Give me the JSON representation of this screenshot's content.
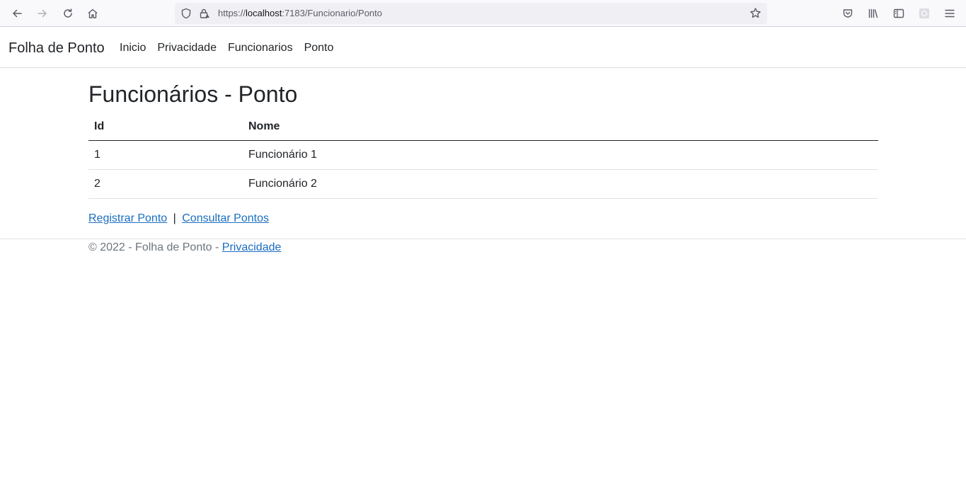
{
  "browser": {
    "url_prefix": "https://",
    "url_host": "localhost",
    "url_rest": ":7183/Funcionario/Ponto"
  },
  "navbar": {
    "brand": "Folha de Ponto",
    "links": [
      "Inicio",
      "Privacidade",
      "Funcionarios",
      "Ponto"
    ]
  },
  "main": {
    "title": "Funcionários - Ponto",
    "table": {
      "headers": [
        "Id",
        "Nome"
      ],
      "rows": [
        [
          "1",
          "Funcionário 1"
        ],
        [
          "2",
          "Funcionário 2"
        ]
      ]
    },
    "actions": {
      "register": "Registrar Ponto",
      "separator": "|",
      "consult": "Consultar Pontos"
    }
  },
  "footer": {
    "text": "© 2022 - Folha de Ponto - ",
    "link": "Privacidade"
  },
  "colors": {
    "link": "#1b6ec2",
    "text": "#212529",
    "muted": "#6c757d"
  }
}
